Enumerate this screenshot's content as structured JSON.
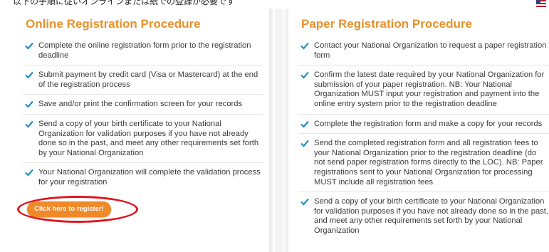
{
  "top_text": "以下の手順に従いオンラインまたは紙での登録が必要です",
  "left_panel": {
    "title": "Online Registration Procedure",
    "items": [
      "Complete the online registration form prior to the registration deadline",
      "Submit payment by credit card (Visa or Mastercard) at the end of the registration process",
      "Save and/or print the confirmation screen for your records",
      "Send a copy of your birth certificate to your National Organization for validation purposes if you have not already done so in the past, and meet any other requirements set forth by your National Organization",
      "Your National Organization will complete the validation process for your registration"
    ],
    "button_label": "Click here to register!"
  },
  "right_panel": {
    "title": "Paper Registration Procedure",
    "items": [
      "Contact your National Organization to request a paper registration form",
      "Confirm the latest date required by your National Organization for submission of your paper registration. NB: Your National Organization MUST input your registration and payment into the online entry system prior to the registration deadline",
      "Complete the registration form and make a copy for your records",
      "Send the completed registration form and all registration fees to your National Organization prior to the registration deadline (do not send paper registration forms directly to the LOC). NB: Paper registrations sent to your National Organization for processing MUST include all registration fees",
      "Send a copy of your birth certificate to your National Organization for validation purposes if you have not already done so in the past, and meet any other requirements set forth by your National Organization"
    ]
  },
  "colors": {
    "accent": "#e8912c",
    "check": "#1f8fc9",
    "highlight_circle": "#e0141c"
  },
  "icons": {
    "check": "check-icon",
    "flag": "us-flag-icon"
  }
}
